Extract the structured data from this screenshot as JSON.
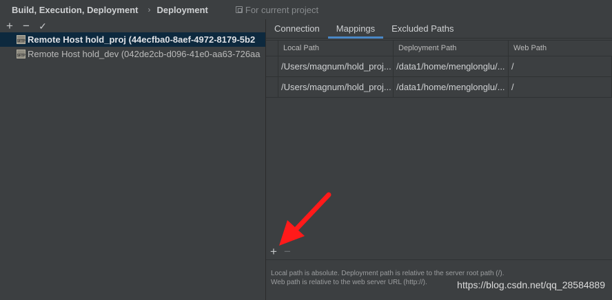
{
  "header": {
    "breadcrumb_parent": "Build, Execution, Deployment",
    "separator": "›",
    "breadcrumb_current": "Deployment",
    "scope_label": "For current project"
  },
  "left_toolbar": {
    "add": "+",
    "remove": "−",
    "apply": "✓"
  },
  "hosts": [
    {
      "label": "Remote Host hold_proj (44ecfba0-8aef-4972-8179-5b2",
      "icon_text": "SFTP",
      "selected": true
    },
    {
      "label": "Remote Host hold_dev (042de2cb-d096-41e0-aa63-726aa",
      "icon_text": "SFTP",
      "selected": false
    }
  ],
  "tabs": [
    {
      "label": "Connection",
      "active": false
    },
    {
      "label": "Mappings",
      "active": true
    },
    {
      "label": "Excluded Paths",
      "active": false
    }
  ],
  "table": {
    "columns": [
      "Local Path",
      "Deployment Path",
      "Web Path"
    ],
    "rows": [
      [
        "/Users/magnum/hold_proj...",
        "/data1/home/menglonglu/...",
        "/"
      ],
      [
        "/Users/magnum/hold_proj...",
        "/data1/home/menglonglu/...",
        "/"
      ]
    ]
  },
  "bottom_toolbar": {
    "add": "+",
    "remove": "−"
  },
  "hints": {
    "line1": "Local path is absolute. Deployment path is relative to the server root path (/).",
    "line2": "Web path is relative to the web server URL (http://)."
  },
  "watermark": "https://blog.csdn.net/qq_28584889",
  "colors": {
    "accent": "#4a88c7",
    "selection": "#0d293e",
    "annotation_arrow": "#ff1a1a"
  }
}
